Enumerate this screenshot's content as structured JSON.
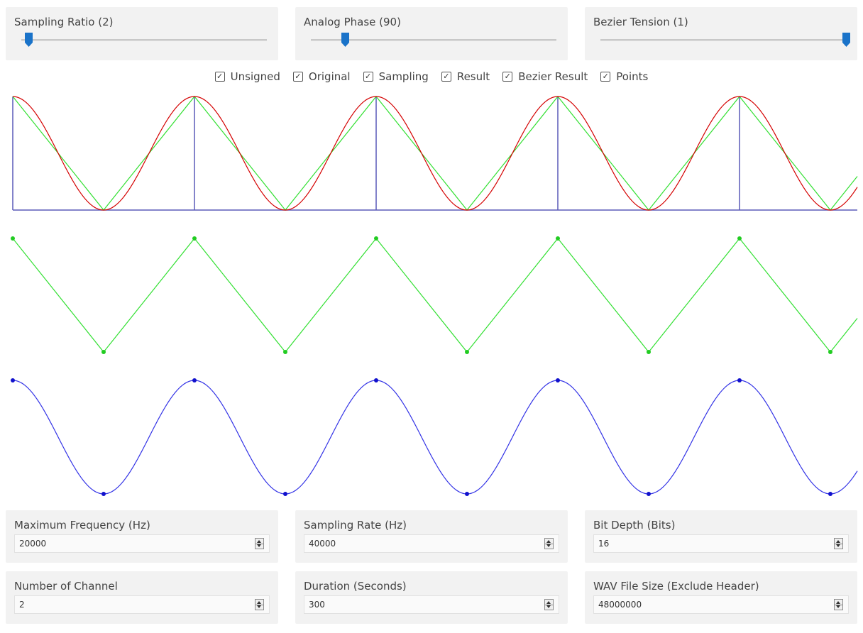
{
  "sliders": [
    {
      "label": "Sampling Ratio (2)",
      "value": 2,
      "min": 2,
      "max": 20
    },
    {
      "label": "Analog Phase (90)",
      "value": 90,
      "min": 0,
      "max": 360
    },
    {
      "label": "Bezier Tension (1)",
      "value": 1,
      "min": 0,
      "max": 1
    }
  ],
  "toggles": [
    {
      "label": "Unsigned",
      "checked": true
    },
    {
      "label": "Original",
      "checked": true
    },
    {
      "label": "Sampling",
      "checked": true
    },
    {
      "label": "Result",
      "checked": true
    },
    {
      "label": "Bezier Result",
      "checked": true
    },
    {
      "label": "Points",
      "checked": true
    }
  ],
  "fields": [
    {
      "label": "Maximum Frequency (Hz)",
      "value": "20000"
    },
    {
      "label": "Sampling Rate (Hz)",
      "value": "40000"
    },
    {
      "label": "Bit Depth (Bits)",
      "value": "16"
    },
    {
      "label": "Number of Channel",
      "value": "2"
    },
    {
      "label": "Duration (Seconds)",
      "value": "300"
    },
    {
      "label": "WAV File Size (Exclude Header)",
      "value": "48000000"
    }
  ],
  "colors": {
    "accent": "#1a73c9",
    "original": "#d40000",
    "sampling": "#5a5ab8",
    "result": "#33e033",
    "bezier": "#3333e6",
    "points_result": "#22cc22",
    "points_bezier": "#1111cc"
  }
}
